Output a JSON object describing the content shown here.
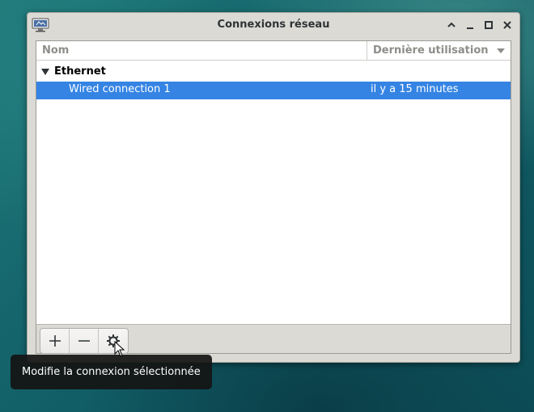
{
  "window": {
    "title": "Connexions réseau"
  },
  "table": {
    "columns": [
      "Nom",
      "Dernière utilisation"
    ],
    "groups": [
      {
        "label": "Ethernet",
        "expanded": true,
        "connections": [
          {
            "name": "Wired connection 1",
            "last_used": "il y a 15 minutes",
            "selected": true
          }
        ]
      }
    ]
  },
  "toolbar": {
    "buttons": [
      {
        "icon": "plus-icon"
      },
      {
        "icon": "minus-icon"
      },
      {
        "icon": "gear-icon"
      }
    ]
  },
  "tooltip": {
    "text": "Modifie la connexion sélectionnée"
  },
  "colors": {
    "selection": "#3584e4",
    "window_bg": "#dcdad5",
    "tooltip_bg": "#141414"
  }
}
